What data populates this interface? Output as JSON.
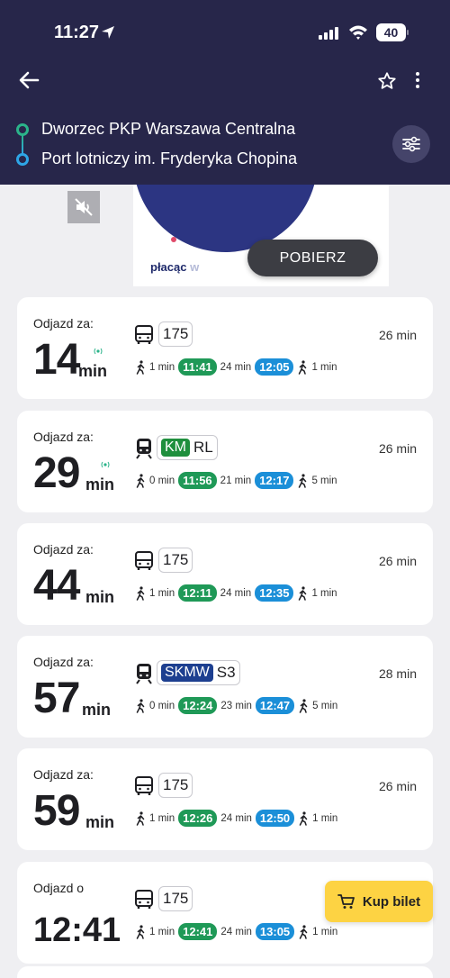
{
  "status": {
    "time": "11:27",
    "battery": "40"
  },
  "route": {
    "from": "Dworzec PKP Warszawa Centralna",
    "to": "Port lotniczy im. Fryderyka Chopina"
  },
  "ad": {
    "text_a": "płacąc",
    "text_b": "w",
    "download_label": "POBIERZ"
  },
  "connections": [
    {
      "label": "Odjazd za:",
      "value": "14",
      "unit": "min",
      "realtime": true,
      "vehicle": "bus-icon",
      "line": "175",
      "duration": "26 min",
      "walk_start": "1 min",
      "dep": "11:41",
      "ride": "24 min",
      "arr": "12:05",
      "walk_end": "1 min"
    },
    {
      "label": "Odjazd za:",
      "value": "29",
      "unit": "min",
      "realtime": true,
      "vehicle": "train-icon",
      "carrier": "KM",
      "line": "RL",
      "duration": "26 min",
      "walk_start": "0 min",
      "dep": "11:56",
      "ride": "21 min",
      "arr": "12:17",
      "walk_end": "5 min"
    },
    {
      "label": "Odjazd za:",
      "value": "44",
      "unit": "min",
      "realtime": false,
      "vehicle": "bus-icon",
      "line": "175",
      "duration": "26 min",
      "walk_start": "1 min",
      "dep": "12:11",
      "ride": "24 min",
      "arr": "12:35",
      "walk_end": "1 min"
    },
    {
      "label": "Odjazd za:",
      "value": "57",
      "unit": "min",
      "realtime": false,
      "vehicle": "train-icon",
      "carrier": "SKMW",
      "line": "S3",
      "duration": "28 min",
      "walk_start": "0 min",
      "dep": "12:24",
      "ride": "23 min",
      "arr": "12:47",
      "walk_end": "5 min"
    },
    {
      "label": "Odjazd za:",
      "value": "59",
      "unit": "min",
      "realtime": false,
      "vehicle": "bus-icon",
      "line": "175",
      "duration": "26 min",
      "walk_start": "1 min",
      "dep": "12:26",
      "ride": "24 min",
      "arr": "12:50",
      "walk_end": "1 min"
    },
    {
      "label": "Odjazd o",
      "value": "12:41",
      "unit": "",
      "realtime": false,
      "vehicle": "bus-icon",
      "line": "175",
      "duration": "",
      "walk_start": "1 min",
      "dep": "12:41",
      "ride": "24 min",
      "arr": "13:05",
      "walk_end": "1 min"
    }
  ],
  "buy_button": {
    "label": "Kup bilet"
  },
  "colors": {
    "header": "#27264a",
    "depart_chip": "#1f9957",
    "arrive_chip": "#1b8fd8",
    "buy": "#fdd343"
  }
}
